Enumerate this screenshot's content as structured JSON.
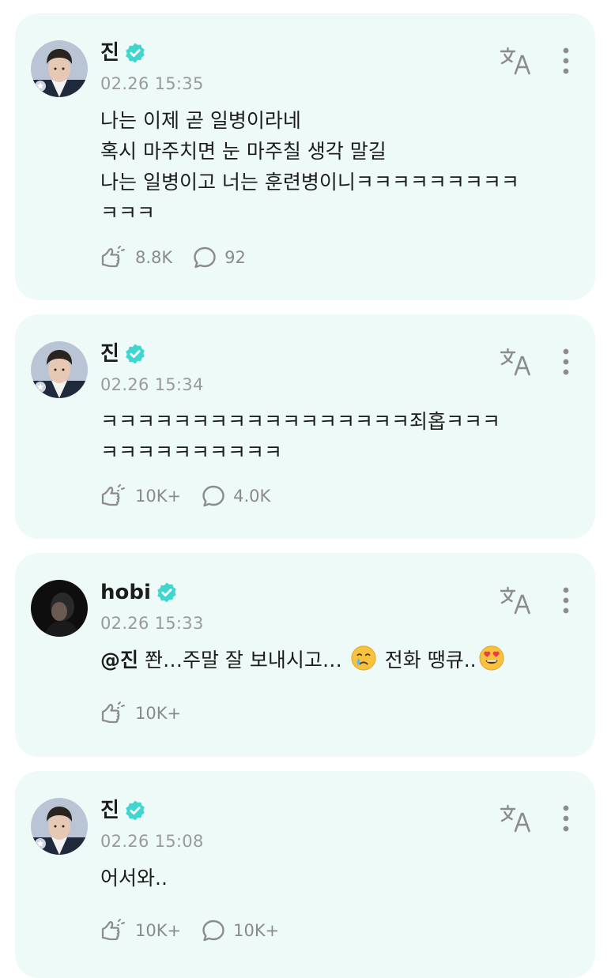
{
  "posts": [
    {
      "author": "진",
      "time": "02.26 15:35",
      "lines": [
        "나는 이제 곧 일병이라네",
        "혹시 마주치면 눈 마주칠 생각 말길",
        "나는 일병이고 너는 훈련병이니ㅋㅋㅋㅋㅋㅋㅋㅋㅋ",
        "ㅋㅋㅋ"
      ],
      "likes": "8.8K",
      "comments": "92",
      "avatar_icon": "jin-profile-photo"
    },
    {
      "author": "진",
      "time": "02.26 15:34",
      "lines": [
        "ㅋㅋㅋㅋㅋㅋㅋㅋㅋㅋㅋㅋㅋㅋㅋㅋㅋ죄홉ㅋㅋㅋ",
        "ㅋㅋㅋㅋㅋㅋㅋㅋㅋㅋ"
      ],
      "likes": "10K+",
      "comments": "4.0K",
      "avatar_icon": "jin-profile-photo"
    },
    {
      "author": "hobi",
      "time": "02.26 15:33",
      "mention": "@진",
      "text_part1": " 쫜…주말 잘 보내시고… ",
      "emoji1": "crying-face-emoji",
      "text_part2": " 전화 땡큐..",
      "emoji2": "heart-eyes-emoji",
      "likes": "10K+",
      "avatar_icon": "hobi-profile-photo"
    },
    {
      "author": "진",
      "time": "02.26 15:08",
      "lines": [
        "어서와.."
      ],
      "likes": "10K+",
      "comments": "10K+",
      "avatar_icon": "jin-profile-photo"
    }
  ],
  "colors": {
    "card_bg": "#eefaf8",
    "verified": "#3fd6d0",
    "muted": "#9a9a9a"
  },
  "icons": [
    "verified-badge-icon",
    "translate-icon",
    "more-options-icon",
    "like-icon",
    "comment-icon"
  ]
}
